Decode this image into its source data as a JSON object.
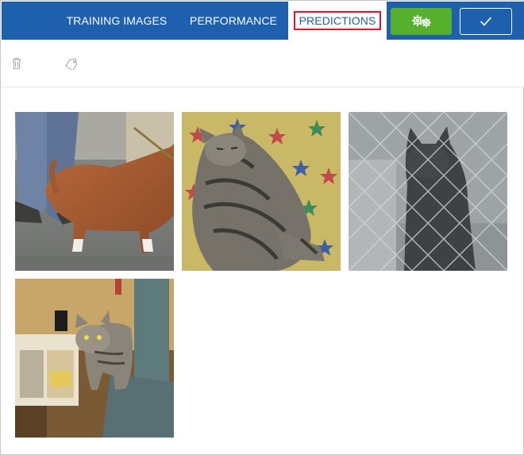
{
  "tabs": {
    "training": "TRAINING IMAGES",
    "performance": "PERFORMANCE",
    "predictions": "PREDICTIONS",
    "active": "predictions"
  },
  "header": {
    "train_icon": "gears-icon",
    "done_icon": "checkmark-icon"
  },
  "toolbar": {
    "delete_icon": "trash-icon",
    "tag_icon": "tag-icon"
  },
  "colors": {
    "header_bg": "#1e5fae",
    "train_button": "#57b02c",
    "highlight_outline": "#e0102a"
  },
  "images": [
    {
      "subject": "dog",
      "icon": "dog-photo"
    },
    {
      "subject": "cat",
      "icon": "cat-photo"
    },
    {
      "subject": "cat",
      "icon": "cat-photo"
    },
    {
      "subject": "cat",
      "icon": "cat-photo"
    }
  ]
}
